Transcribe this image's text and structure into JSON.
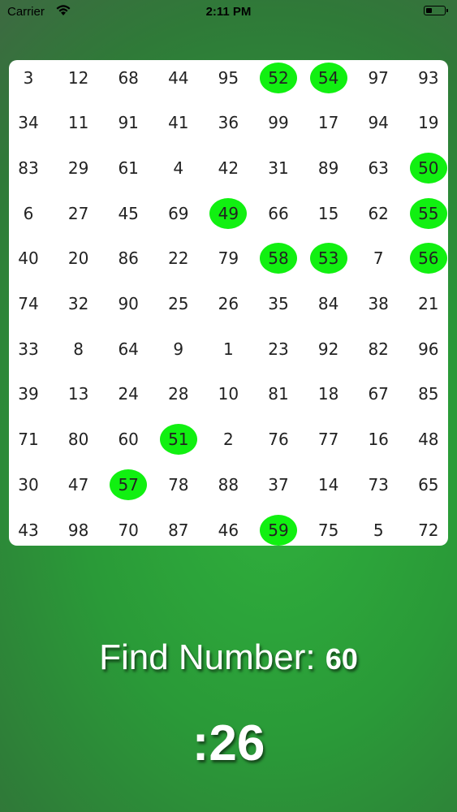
{
  "status_bar": {
    "carrier": "Carrier",
    "time": "2:11 PM",
    "battery_level": 0.35
  },
  "grid": {
    "rows": [
      [
        3,
        12,
        68,
        44,
        95,
        52,
        54,
        97,
        93
      ],
      [
        34,
        11,
        91,
        41,
        36,
        99,
        17,
        94,
        19
      ],
      [
        83,
        29,
        61,
        4,
        42,
        31,
        89,
        63,
        50
      ],
      [
        6,
        27,
        45,
        69,
        49,
        66,
        15,
        62,
        55
      ],
      [
        40,
        20,
        86,
        22,
        79,
        58,
        53,
        7,
        56
      ],
      [
        74,
        32,
        90,
        25,
        26,
        35,
        84,
        38,
        21
      ],
      [
        33,
        8,
        64,
        9,
        1,
        23,
        92,
        82,
        96
      ],
      [
        39,
        13,
        24,
        28,
        10,
        81,
        18,
        67,
        85
      ],
      [
        71,
        80,
        60,
        51,
        2,
        76,
        77,
        16,
        48
      ],
      [
        30,
        47,
        57,
        78,
        88,
        37,
        14,
        73,
        65
      ],
      [
        43,
        98,
        70,
        87,
        46,
        59,
        75,
        5,
        72
      ]
    ],
    "found_numbers": [
      49,
      50,
      51,
      52,
      53,
      54,
      55,
      56,
      57,
      58,
      59
    ],
    "highlight_color": "#11f011"
  },
  "game": {
    "find_label": "Find Number:",
    "target_number": "60",
    "timer": ":26"
  }
}
